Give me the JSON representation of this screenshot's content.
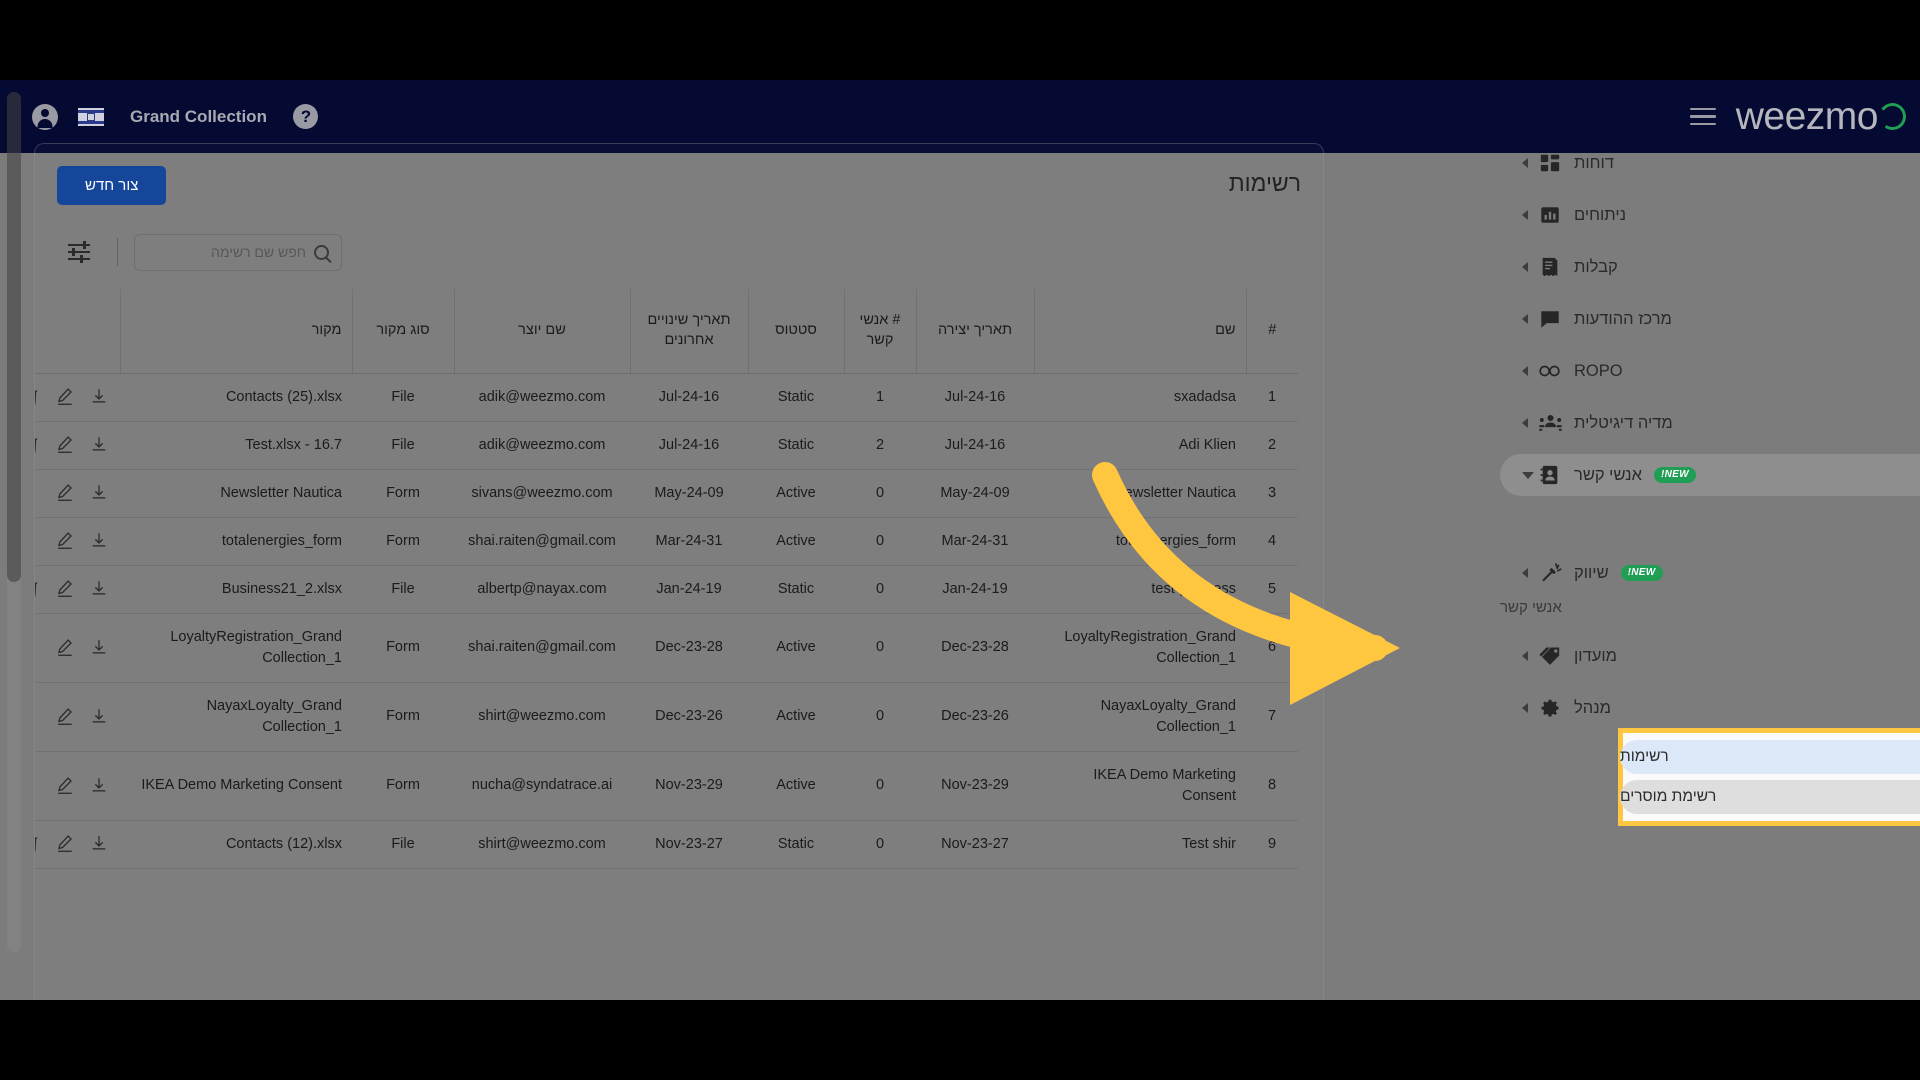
{
  "topnav": {
    "brand": "Grand Collection",
    "account_icon": "account-circle-icon",
    "flag_icon": "israel-flag-icon",
    "help_icon": "help-circle-icon",
    "menu_icon": "hamburger-menu-icon",
    "logo_text": "weezmo",
    "logo_accent": "#1f9e54"
  },
  "page": {
    "title": "רשימות",
    "create_button": "צור חדש",
    "filter_icon": "filter-sliders-icon",
    "search_placeholder": "חפש שם רשימה",
    "search_value": "",
    "search_icon": "search-icon"
  },
  "table": {
    "headers": {
      "idx": "#",
      "name": "שם",
      "created": "תאריך יצירה",
      "contacts": "# אנשי קשר",
      "status": "סטטוס",
      "modified": "תאריך שינויים אחרונים",
      "owner": "שם יוצר",
      "source_type": "סוג מקור",
      "source": "מקור",
      "actions": ""
    },
    "rows": [
      {
        "idx": "1",
        "name": "sxadadsa",
        "created": "Jul-24-16",
        "contacts": "1",
        "status": "Static",
        "modified": "Jul-24-16",
        "owner": "adik@weezmo.com",
        "source_type": "File",
        "source": "Contacts (25).xlsx",
        "can_delete": true
      },
      {
        "idx": "2",
        "name": "Adi Klien",
        "created": "Jul-24-16",
        "contacts": "2",
        "status": "Static",
        "modified": "Jul-24-16",
        "owner": "adik@weezmo.com",
        "source_type": "File",
        "source": "Test.xlsx - 16.7",
        "can_delete": true
      },
      {
        "idx": "3",
        "name": "Newsletter Nautica",
        "created": "May-24-09",
        "contacts": "0",
        "status": "Active",
        "modified": "May-24-09",
        "owner": "sivans@weezmo.com",
        "source_type": "Form",
        "source": "Newsletter Nautica",
        "can_delete": false
      },
      {
        "idx": "4",
        "name": "totalenergies_form",
        "created": "Mar-24-31",
        "contacts": "0",
        "status": "Active",
        "modified": "Mar-24-31",
        "owner": "shai.raiten@gmail.com",
        "source_type": "Form",
        "source": "totalenergies_form",
        "can_delete": false
      },
      {
        "idx": "5",
        "name": "test-progress",
        "created": "Jan-24-19",
        "contacts": "0",
        "status": "Static",
        "modified": "Jan-24-19",
        "owner": "albertp@nayax.com",
        "source_type": "File",
        "source": "Business21_2.xlsx",
        "can_delete": true
      },
      {
        "idx": "6",
        "name": "LoyaltyRegistration_Grand Collection_1",
        "created": "Dec-23-28",
        "contacts": "0",
        "status": "Active",
        "modified": "Dec-23-28",
        "owner": "shai.raiten@gmail.com",
        "source_type": "Form",
        "source": "LoyaltyRegistration_Grand Collection_1",
        "can_delete": false
      },
      {
        "idx": "7",
        "name": "NayaxLoyalty_Grand Collection_1",
        "created": "Dec-23-26",
        "contacts": "0",
        "status": "Active",
        "modified": "Dec-23-26",
        "owner": "shirt@weezmo.com",
        "source_type": "Form",
        "source": "NayaxLoyalty_Grand Collection_1",
        "can_delete": false
      },
      {
        "idx": "8",
        "name": "IKEA Demo Marketing Consent",
        "created": "Nov-23-29",
        "contacts": "0",
        "status": "Active",
        "modified": "Nov-23-29",
        "owner": "nucha@syndatrace.ai",
        "source_type": "Form",
        "source": "IKEA Demo Marketing Consent",
        "can_delete": false
      },
      {
        "idx": "9",
        "name": "Test shir",
        "created": "Nov-23-27",
        "contacts": "0",
        "status": "Static",
        "modified": "Nov-23-27",
        "owner": "shirt@weezmo.com",
        "source_type": "File",
        "source": "Contacts (12).xlsx",
        "can_delete": true
      }
    ]
  },
  "sidebar": {
    "items": [
      {
        "label": "דוחות",
        "icon": "dashboard-grid-icon",
        "badge": "",
        "expanded": false
      },
      {
        "label": "ניתוחים",
        "icon": "bar-chart-icon",
        "badge": "",
        "expanded": false
      },
      {
        "label": "קבלות",
        "icon": "receipt-icon",
        "badge": "",
        "expanded": false
      },
      {
        "label": "מרכז ההודעות",
        "icon": "chat-bubble-icon",
        "badge": "",
        "expanded": false
      },
      {
        "label": "ROPO",
        "icon": "infinity-icon",
        "badge": "",
        "expanded": false
      },
      {
        "label": "מדיה דיגיטלית",
        "icon": "people-group-icon",
        "badge": "",
        "expanded": false
      },
      {
        "label": "אנשי קשר",
        "icon": "contact-card-icon",
        "badge": "NEW!",
        "expanded": true
      },
      {
        "label": "שיווק",
        "icon": "megaphone-icon",
        "badge": "NEW!",
        "expanded": false
      },
      {
        "label": "מועדון",
        "icon": "tag-icon",
        "badge": "",
        "expanded": false
      },
      {
        "label": "מנהל",
        "icon": "gear-icon",
        "badge": "",
        "expanded": false
      }
    ],
    "submenu_header": "אנשי קשר",
    "submenu": [
      {
        "label": "רשימות",
        "selected": true
      },
      {
        "label": "רשימת מוסרים",
        "selected": false
      }
    ],
    "highlight_color": "#ffc63f",
    "badge_color": "#1f9e54"
  },
  "annotation": {
    "arrow_color": "#ffc63f",
    "arrow_name": "yellow-pointer-arrow"
  }
}
